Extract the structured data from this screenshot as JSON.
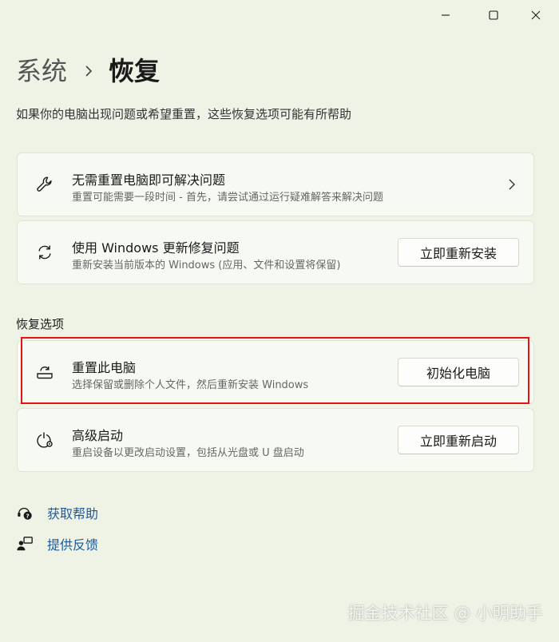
{
  "window": {
    "minimize_label": "",
    "maximize_label": "",
    "close_label": ""
  },
  "breadcrumb": {
    "parent": "系统",
    "current": "恢复"
  },
  "description": "如果你的电脑出现问题或希望重置，这些恢复选项可能有所帮助",
  "cards": {
    "troubleshoot": {
      "icon": "wrench-icon",
      "title": "无需重置电脑即可解决问题",
      "subtitle": "重置可能需要一段时间 - 首先，请尝试通过运行疑难解答来解决问题"
    },
    "windows_update_fix": {
      "icon": "refresh-icon",
      "title": "使用 Windows 更新修复问题",
      "subtitle": "重新安装当前版本的 Windows (应用、文件和设置将保留)",
      "button": "立即重新安装"
    }
  },
  "recovery_options": {
    "heading": "恢复选项",
    "reset_pc": {
      "icon": "reset-pc-icon",
      "title": "重置此电脑",
      "subtitle": "选择保留或删除个人文件，然后重新安装 Windows",
      "button": "初始化电脑"
    },
    "advanced_startup": {
      "icon": "power-gear-icon",
      "title": "高级启动",
      "subtitle": "重启设备以更改启动设置，包括从光盘或 U 盘启动",
      "button": "立即重新启动"
    }
  },
  "links": {
    "get_help": "获取帮助",
    "give_feedback": "提供反馈"
  },
  "watermark": "掘金技术社区 @ 小明助手",
  "colors": {
    "background": "#eef3e6",
    "card": "#f7faf2",
    "link": "#1c5aa0",
    "highlight": "#e21414"
  }
}
